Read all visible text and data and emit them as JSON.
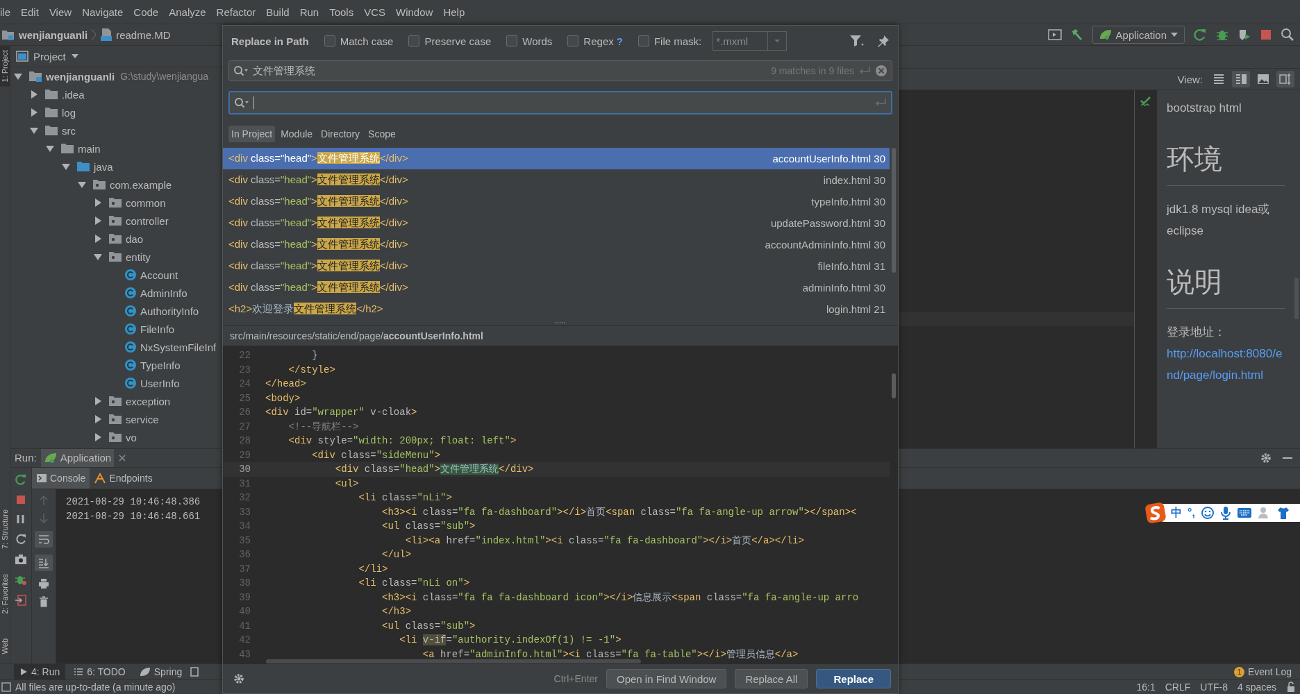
{
  "menu": [
    "ile",
    "Edit",
    "View",
    "Navigate",
    "Code",
    "Analyze",
    "Refactor",
    "Build",
    "Run",
    "Tools",
    "VCS",
    "Window",
    "Help"
  ],
  "breadcrumb": {
    "project": "wenjianguanli",
    "file": "readme.MD"
  },
  "run_config": "Application",
  "side_tabs": [
    {
      "label": "1: Project",
      "selected": true
    },
    {
      "label": "7: Structure",
      "selected": false
    },
    {
      "label": "2: Favorites",
      "selected": false
    },
    {
      "label": "Web",
      "selected": false
    }
  ],
  "project_panel": {
    "title": "Project",
    "tree": [
      {
        "label": "wenjianguanli",
        "path": "G:\\study\\wenjiangua",
        "kind": "module",
        "expanded": true,
        "children": [
          {
            "label": ".idea",
            "kind": "folder",
            "expanded": false
          },
          {
            "label": "log",
            "kind": "folder",
            "expanded": false
          },
          {
            "label": "src",
            "kind": "folder",
            "expanded": true,
            "children": [
              {
                "label": "main",
                "kind": "folder",
                "expanded": true,
                "children": [
                  {
                    "label": "java",
                    "kind": "source_folder",
                    "expanded": true,
                    "children": [
                      {
                        "label": "com.example",
                        "kind": "package",
                        "expanded": true,
                        "children": [
                          {
                            "label": "common",
                            "kind": "package",
                            "expanded": false
                          },
                          {
                            "label": "controller",
                            "kind": "package",
                            "expanded": false
                          },
                          {
                            "label": "dao",
                            "kind": "package",
                            "expanded": false
                          },
                          {
                            "label": "entity",
                            "kind": "package",
                            "expanded": true,
                            "children": [
                              {
                                "label": "Account",
                                "kind": "class"
                              },
                              {
                                "label": "AdminInfo",
                                "kind": "class"
                              },
                              {
                                "label": "AuthorityInfo",
                                "kind": "class"
                              },
                              {
                                "label": "FileInfo",
                                "kind": "class"
                              },
                              {
                                "label": "NxSystemFileInf",
                                "kind": "class"
                              },
                              {
                                "label": "TypeInfo",
                                "kind": "class"
                              },
                              {
                                "label": "UserInfo",
                                "kind": "class"
                              }
                            ]
                          },
                          {
                            "label": "exception",
                            "kind": "package",
                            "expanded": false
                          },
                          {
                            "label": "service",
                            "kind": "package",
                            "expanded": false
                          },
                          {
                            "label": "vo",
                            "kind": "package",
                            "expanded": false
                          }
                        ]
                      }
                    ]
                  }
                ]
              }
            ]
          }
        ]
      }
    ]
  },
  "editor": {
    "view_label": "View:",
    "view_modes": [
      {
        "kind": "editor",
        "selected": false
      },
      {
        "kind": "split",
        "selected": true
      },
      {
        "kind": "preview",
        "selected": false
      }
    ]
  },
  "preview": [
    {
      "kind": "paragraph",
      "text": "bootstrap html"
    },
    {
      "kind": "heading",
      "text": "环境"
    },
    {
      "kind": "paragraph",
      "text": "jdk1.8 mysql idea或eclipse"
    },
    {
      "kind": "heading",
      "text": "说明"
    },
    {
      "kind": "address",
      "text": "登录地址：",
      "link": "http://localhost:8080/end/page/login.html"
    }
  ],
  "run_panel": {
    "label": "Run:",
    "tab": "Application",
    "subtabs": [
      {
        "label": "Console",
        "selected": true
      },
      {
        "label": "Endpoints",
        "selected": false
      }
    ],
    "lines": [
      "2021-08-29 10:46:48.386",
      "2021-08-29 10:46:48.661"
    ]
  },
  "bottom_tabs": [
    {
      "label": "4: Run",
      "kind": "run",
      "selected": true
    },
    {
      "label": "6: TODO",
      "kind": "todo",
      "selected": false
    },
    {
      "label": "Spring",
      "kind": "spring",
      "selected": false
    }
  ],
  "event_log": {
    "count": "1",
    "label": "Event Log"
  },
  "status_bar": {
    "message": "All files are up-to-date (a minute ago)",
    "items": [
      "16:1",
      "CRLF",
      "UTF-8",
      "4 spaces"
    ]
  },
  "ime": {
    "mode": "中",
    "punctuation": "°,"
  },
  "dialog": {
    "title": "Replace in Path",
    "options": [
      {
        "label": "Match case",
        "checked": false
      },
      {
        "label": "Preserve case",
        "checked": false
      },
      {
        "label": "Words",
        "checked": false
      },
      {
        "label": "Regex",
        "checked": false,
        "help": "?"
      },
      {
        "label": "File mask:",
        "checked": false
      }
    ],
    "file_mask": {
      "value": "*.mxml",
      "disabled": true
    },
    "search": "文件管理系统",
    "match_count": "9 matches in 9 files",
    "scopes": [
      {
        "label": "In Project",
        "selected": true
      },
      {
        "label": "Module",
        "selected": false
      },
      {
        "label": "Directory",
        "selected": false
      },
      {
        "label": "Scope",
        "selected": false
      }
    ],
    "results": [
      {
        "before": "<div class=\"head\">",
        "match": "文件管理系统",
        "after": "</div>",
        "file": "accountUserInfo.html",
        "line": "30",
        "selected": true
      },
      {
        "before": "<div class=\"head\">",
        "match": "文件管理系统",
        "after": "</div>",
        "file": "index.html",
        "line": "30",
        "selected": false
      },
      {
        "before": "<div class=\"head\">",
        "match": "文件管理系统",
        "after": "</div>",
        "file": "typeInfo.html",
        "line": "30",
        "selected": false
      },
      {
        "before": "<div class=\"head\">",
        "match": "文件管理系统",
        "after": "</div>",
        "file": "updatePassword.html",
        "line": "30",
        "selected": false
      },
      {
        "before": "<div class=\"head\">",
        "match": "文件管理系统",
        "after": "</div>",
        "file": "accountAdminInfo.html",
        "line": "30",
        "selected": false
      },
      {
        "before": "<div class=\"head\">",
        "match": "文件管理系统",
        "after": "</div>",
        "file": "fileInfo.html",
        "line": "31",
        "selected": false
      },
      {
        "before": "<div class=\"head\">",
        "match": "文件管理系统",
        "after": "</div>",
        "file": "adminInfo.html",
        "line": "30",
        "selected": false
      },
      {
        "before": "<h2>欢迎登录",
        "match": "文件管理系统",
        "after": "</h2>",
        "file": "login.html",
        "line": "21",
        "selected": false
      }
    ],
    "preview_path": "src/main/resources/static/end/page/**accountUserInfo.html**",
    "code": [
      {
        "n": "22",
        "current": false,
        "text": "        }"
      },
      {
        "n": "23",
        "current": false,
        "text": "    </style>"
      },
      {
        "n": "24",
        "current": false,
        "text": "</head>"
      },
      {
        "n": "25",
        "current": false,
        "text": "<body>"
      },
      {
        "n": "26",
        "current": false,
        "text": "<div id=\"wrapper\" v-cloak>"
      },
      {
        "n": "27",
        "current": false,
        "text": "    <!--导航栏-->"
      },
      {
        "n": "28",
        "current": false,
        "text": "    <div style=\"width: 200px; float: left\">"
      },
      {
        "n": "29",
        "current": false,
        "text": "        <div class=\"sideMenu\">"
      },
      {
        "n": "30",
        "current": true,
        "text": "            <div class=\"head\">",
        "hit": {
          "text": "文件管理系统",
          "kind": "search"
        },
        "after": "</div>"
      },
      {
        "n": "31",
        "current": false,
        "text": "            <ul>"
      },
      {
        "n": "32",
        "current": false,
        "text": "                <li class=\"nLi\">"
      },
      {
        "n": "33",
        "current": false,
        "text": "                    <h3><i class=\"fa fa-dashboard\"></i>首页<span class=\"fa fa-angle-up arrow\"></span><"
      },
      {
        "n": "34",
        "current": false,
        "text": "                    <ul class=\"sub\">"
      },
      {
        "n": "35",
        "current": false,
        "text": "                        <li><a href=\"index.html\"><i class=\"fa fa-dashboard\"></i>首页</a></li>"
      },
      {
        "n": "36",
        "current": false,
        "text": "                    </ul>"
      },
      {
        "n": "37",
        "current": false,
        "text": "                </li>"
      },
      {
        "n": "38",
        "current": false,
        "text": "                <li class=\"nLi on\">"
      },
      {
        "n": "39",
        "current": false,
        "text": "                    <h3><i class=\"fa fa fa-dashboard icon\"></i>信息展示<span class=\"fa fa-angle-up arro"
      },
      {
        "n": "40",
        "current": false,
        "text": "                    </h3>"
      },
      {
        "n": "41",
        "current": false,
        "text": "                    <ul class=\"sub\">"
      },
      {
        "n": "42",
        "current": false,
        "text": "                       <li ",
        "hit": {
          "text": "v-if",
          "kind": "usage"
        },
        "after": "=\"authority.indexOf(1) != -1\">"
      },
      {
        "n": "43",
        "current": false,
        "text": "                           <a href=\"adminInfo.html\"><i class=\"fa fa-table\"></i>管理员信息</a>"
      }
    ],
    "shortcut": "Ctrl+Enter",
    "buttons": [
      {
        "label": "Open in Find Window",
        "kind": "normal"
      },
      {
        "label": "Replace All",
        "kind": "normal"
      },
      {
        "label": "Replace",
        "kind": "primary"
      }
    ]
  }
}
